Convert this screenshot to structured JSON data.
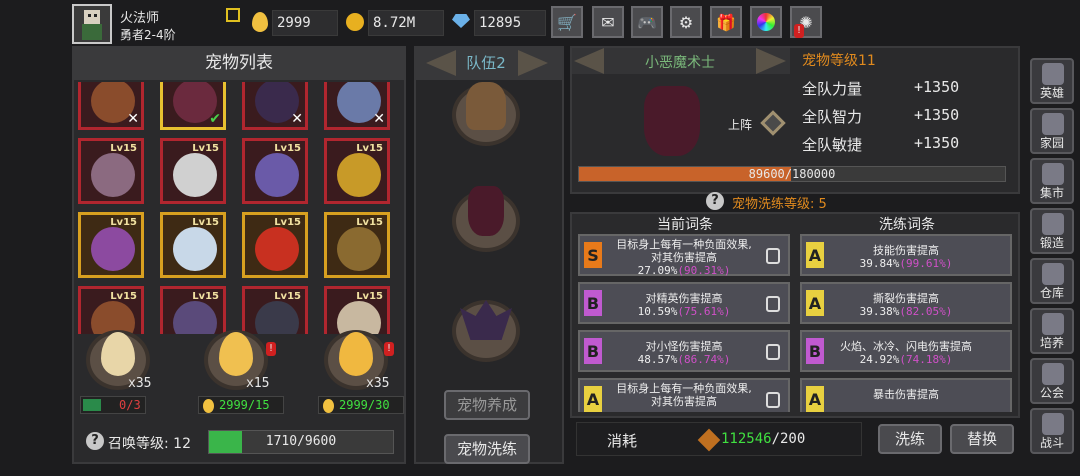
{
  "player": {
    "name": "火法师",
    "rank": "勇者2-4阶"
  },
  "resources": {
    "eggs": "2999",
    "gold": "8.72M",
    "gems": "12895"
  },
  "toolbar_icons": [
    "cart-icon",
    "mail-icon",
    "gamepad-icon",
    "gear-icon",
    "gift-icon",
    "color-wheel-icon",
    "fireworks-icon"
  ],
  "pet_list": {
    "title": "宠物列表",
    "grid": [
      {
        "lv": "",
        "color": "#8a4c2c"
      },
      {
        "lv": "",
        "color": "#6b2a3e"
      },
      {
        "lv": "",
        "color": "#3a2a4c"
      },
      {
        "lv": "",
        "color": "#6a7aa8"
      },
      {
        "lv": "Lv15",
        "color": "#8b6a80"
      },
      {
        "lv": "Lv15",
        "color": "#d0d0d0"
      },
      {
        "lv": "Lv15",
        "color": "#6a5aa8"
      },
      {
        "lv": "Lv15",
        "color": "#c89a28"
      },
      {
        "lv": "Lv15",
        "color": "#8c4aa0"
      },
      {
        "lv": "Lv15",
        "color": "#c8d8e8"
      },
      {
        "lv": "Lv15",
        "color": "#c83020"
      },
      {
        "lv": "Lv15",
        "color": "#8a6a30"
      },
      {
        "lv": "Lv15",
        "color": "#8a4c2c"
      },
      {
        "lv": "Lv15",
        "color": "#5a4a7a"
      },
      {
        "lv": "Lv15",
        "color": "#3a3a4a"
      },
      {
        "lv": "Lv15",
        "color": "#c8b8a0"
      }
    ],
    "eggs": [
      {
        "count": "x35",
        "cost": "0/3",
        "cost_icon": "video-icon"
      },
      {
        "count": "x15",
        "cost": "2999/15",
        "cost_icon": "egg-icon"
      },
      {
        "count": "x35",
        "cost": "2999/30",
        "cost_icon": "egg-icon"
      }
    ],
    "summon_label": "召唤等级: 12",
    "summon_progress": "1710/9600",
    "summon_fraction": 0.18
  },
  "team": {
    "title": "队伍2",
    "buttons": {
      "train": "宠物养成",
      "refine": "宠物洗练"
    }
  },
  "pet_detail": {
    "name": "小恶魔术士",
    "level_label": "宠物等级11",
    "deploy_label": "上阵",
    "stats": [
      {
        "label": "全队力量",
        "value": "+1350"
      },
      {
        "label": "全队智力",
        "value": "+1350"
      },
      {
        "label": "全队敏捷",
        "value": "+1350"
      }
    ],
    "exp": "89600/180000",
    "exp_fraction": 0.498,
    "refine_level": "宠物洗练等级: 5"
  },
  "refine": {
    "current_title": "当前词条",
    "new_title": "洗练词条",
    "current": [
      {
        "grade": "S",
        "line1": "目标身上每有一种负面效果,",
        "line2": "对其伤害提高",
        "value": "27.09%",
        "max": "(90.31%)"
      },
      {
        "grade": "B",
        "line1": "对精英伤害提高",
        "line2": "",
        "value": "10.59%",
        "max": "(75.61%)"
      },
      {
        "grade": "B",
        "line1": "对小怪伤害提高",
        "line2": "",
        "value": "48.57%",
        "max": "(86.74%)"
      },
      {
        "grade": "A",
        "line1": "目标身上每有一种负面效果,",
        "line2": "对其伤害提高",
        "value": "",
        "max": ""
      }
    ],
    "new": [
      {
        "grade": "A",
        "line1": "技能伤害提高",
        "value": "39.84%",
        "max": "(99.61%)"
      },
      {
        "grade": "A",
        "line1": "撕裂伤害提高",
        "value": "39.38%",
        "max": "(82.05%)"
      },
      {
        "grade": "B",
        "line1": "火焰、冰冷、闪电伤害提高",
        "value": "24.92%",
        "max": "(74.18%)"
      },
      {
        "grade": "A",
        "line1": "暴击伤害提高",
        "value": "",
        "max": ""
      }
    ],
    "cost_label": "消耗",
    "cost_have": "112546",
    "cost_need": "/200",
    "btn_refine": "洗练",
    "btn_replace": "替换"
  },
  "side_menu": [
    {
      "label": "英雄",
      "icon": "helmet-icon"
    },
    {
      "label": "家园",
      "icon": "house-icon"
    },
    {
      "label": "集市",
      "icon": "shop-icon"
    },
    {
      "label": "锻造",
      "icon": "anvil-icon"
    },
    {
      "label": "仓库",
      "icon": "chest-icon"
    },
    {
      "label": "培养",
      "icon": "wizard-icon"
    },
    {
      "label": "公会",
      "icon": "guild-icon"
    },
    {
      "label": "战斗",
      "icon": "portal-icon"
    }
  ],
  "colors": {
    "accent_orange": "#e08a1e",
    "exp_bar": "#c8632a",
    "summon_bar": "#3ab54a",
    "red_border": "#b1262f"
  }
}
